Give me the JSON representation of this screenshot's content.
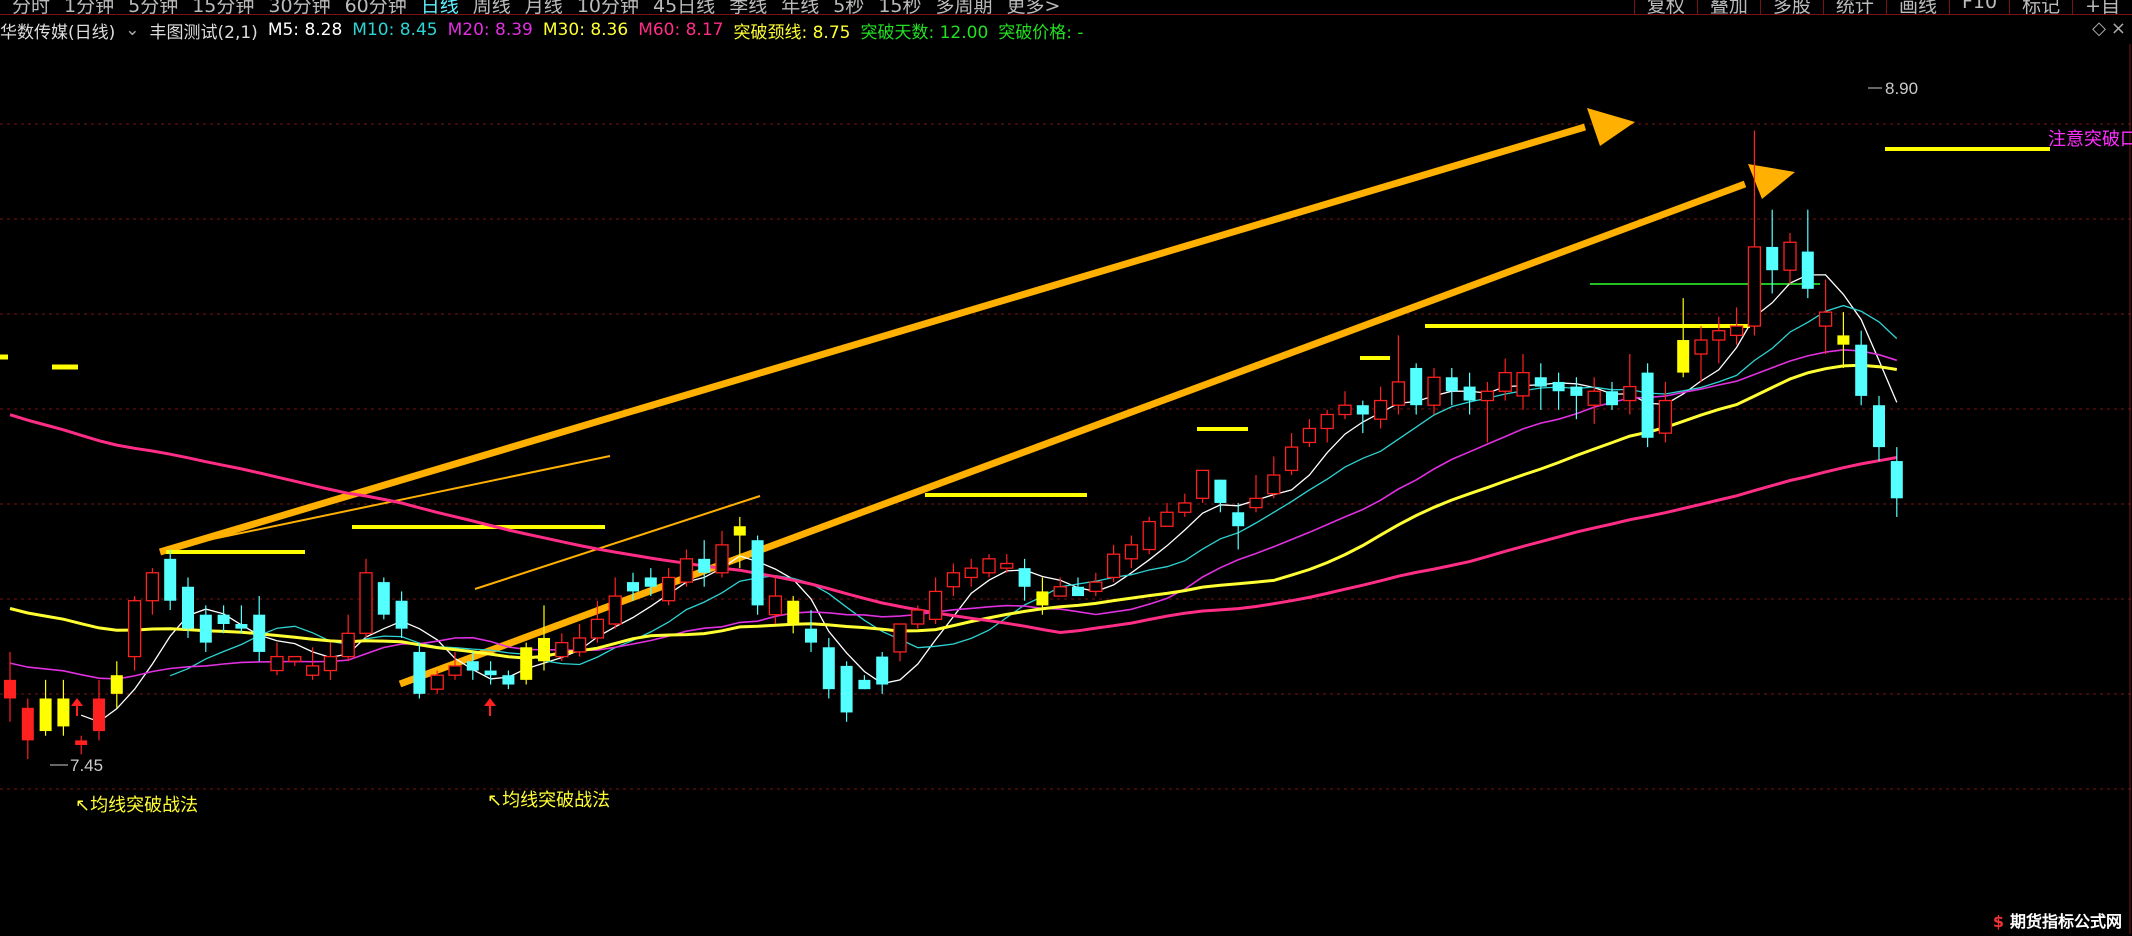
{
  "topbar": {
    "periods": [
      "分时",
      "1分钟",
      "5分钟",
      "15分钟",
      "30分钟",
      "60分钟",
      "日线",
      "周线",
      "月线",
      "10分钟",
      "45日线",
      "季线",
      "年线",
      "5秒",
      "15秒",
      "多周期",
      "更多>"
    ],
    "active_period": "日线",
    "tools": [
      "复权",
      "叠加",
      "多股",
      "统计",
      "画线",
      "F10",
      "标记",
      "+自"
    ]
  },
  "info": {
    "stock_name": "华数传媒(日线)",
    "indicator": "丰图测试(2,1)",
    "ma5": "M5: 8.28",
    "ma10": "M10: 8.45",
    "ma20": "M20: 8.39",
    "ma30": "M30: 8.36",
    "ma60": "M60: 8.17",
    "neckline": "突破颈线: 8.75",
    "days": "突破天数: 12.00",
    "price": "突破价格: -"
  },
  "annotations": {
    "high": "8.90",
    "low": "7.45",
    "note1": "↖均线突破战法",
    "note2": "↖均线突破战法",
    "alert": "注意突破口"
  },
  "watermark": {
    "symbol": "$",
    "text": "期货指标公式网"
  },
  "colors": {
    "up": "#ff2020",
    "down": "#54ffff",
    "mark": "#ffff00",
    "ma5": "#ffffff",
    "ma10": "#2ed3d3",
    "ma20": "#e030e0",
    "ma30": "#ffff33",
    "ma60": "#ff2d86",
    "arrow": "#ffb000",
    "grid": "#7a1414"
  },
  "chart_data": {
    "type": "candlestick",
    "price_high": 8.9,
    "price_low": 7.45,
    "candles": [
      [
        "o",
        7.62,
        7.58,
        7.68,
        7.53
      ],
      [
        "o",
        7.56,
        7.49,
        7.58,
        7.45
      ],
      [
        "y",
        7.51,
        7.58,
        7.62,
        7.5
      ],
      [
        "y",
        7.52,
        7.58,
        7.62,
        7.5
      ],
      [
        "o",
        7.48,
        7.49,
        7.5,
        7.46
      ],
      [
        "o",
        7.58,
        7.51,
        7.62,
        7.49
      ],
      [
        "y",
        7.59,
        7.63,
        7.66,
        7.56
      ],
      [
        "r",
        7.67,
        7.79,
        7.8,
        7.64
      ],
      [
        "r",
        7.79,
        7.85,
        7.86,
        7.76
      ],
      [
        "c",
        7.88,
        7.79,
        7.9,
        7.77
      ],
      [
        "c",
        7.82,
        7.73,
        7.84,
        7.71
      ],
      [
        "c",
        7.76,
        7.7,
        7.78,
        7.68
      ],
      [
        "c",
        7.76,
        7.74,
        7.78,
        7.72
      ],
      [
        "c",
        7.74,
        7.73,
        7.78,
        7.72
      ],
      [
        "c",
        7.76,
        7.68,
        7.8,
        7.66
      ],
      [
        "r",
        7.64,
        7.67,
        7.7,
        7.63
      ],
      [
        "r",
        7.66,
        7.67,
        7.67,
        7.65
      ],
      [
        "r",
        7.63,
        7.65,
        7.69,
        7.62
      ],
      [
        "r",
        7.64,
        7.67,
        7.7,
        7.62
      ],
      [
        "r",
        7.67,
        7.72,
        7.76,
        7.66
      ],
      [
        "r",
        7.72,
        7.85,
        7.88,
        7.71
      ],
      [
        "c",
        7.83,
        7.76,
        7.84,
        7.75
      ],
      [
        "c",
        7.79,
        7.73,
        7.81,
        7.71
      ],
      [
        "c",
        7.68,
        7.59,
        7.7,
        7.58
      ],
      [
        "r",
        7.63,
        7.6,
        7.64,
        7.59
      ],
      [
        "r",
        7.63,
        7.65,
        7.68,
        7.62
      ],
      [
        "c",
        7.66,
        7.64,
        7.68,
        7.62
      ],
      [
        "c",
        7.64,
        7.63,
        7.66,
        7.61
      ],
      [
        "c",
        7.63,
        7.61,
        7.64,
        7.6
      ],
      [
        "y",
        7.62,
        7.69,
        7.7,
        7.61
      ],
      [
        "y",
        7.66,
        7.71,
        7.78,
        7.64
      ],
      [
        "r",
        7.67,
        7.7,
        7.72,
        7.66
      ],
      [
        "r",
        7.68,
        7.71,
        7.74,
        7.67
      ],
      [
        "r",
        7.71,
        7.75,
        7.79,
        7.7
      ],
      [
        "r",
        7.74,
        7.8,
        7.84,
        7.73
      ],
      [
        "c",
        7.83,
        7.81,
        7.85,
        7.79
      ],
      [
        "c",
        7.84,
        7.82,
        7.86,
        7.8
      ],
      [
        "r",
        7.79,
        7.84,
        7.86,
        7.78
      ],
      [
        "r",
        7.83,
        7.88,
        7.9,
        7.82
      ],
      [
        "c",
        7.88,
        7.85,
        7.92,
        7.82
      ],
      [
        "r",
        7.85,
        7.91,
        7.94,
        7.84
      ],
      [
        "y",
        7.93,
        7.95,
        7.97,
        7.86
      ],
      [
        "c",
        7.92,
        7.78,
        7.93,
        7.76
      ],
      [
        "r",
        7.76,
        7.8,
        7.84,
        7.74
      ],
      [
        "y",
        7.79,
        7.74,
        7.8,
        7.72
      ],
      [
        "c",
        7.73,
        7.7,
        7.77,
        7.68
      ],
      [
        "c",
        7.69,
        7.6,
        7.71,
        7.58
      ],
      [
        "c",
        7.65,
        7.55,
        7.66,
        7.53
      ],
      [
        "c",
        7.62,
        7.6,
        7.63,
        7.6
      ],
      [
        "c",
        7.67,
        7.61,
        7.68,
        7.59
      ],
      [
        "r",
        7.68,
        7.74,
        7.74,
        7.66
      ],
      [
        "r",
        7.74,
        7.77,
        7.78,
        7.73
      ],
      [
        "r",
        7.75,
        7.81,
        7.84,
        7.74
      ],
      [
        "r",
        7.82,
        7.85,
        7.87,
        7.8
      ],
      [
        "r",
        7.84,
        7.86,
        7.88,
        7.82
      ],
      [
        "r",
        7.85,
        7.88,
        7.89,
        7.84
      ],
      [
        "r",
        7.86,
        7.87,
        7.89,
        7.85
      ],
      [
        "c",
        7.86,
        7.82,
        7.88,
        7.79
      ],
      [
        "y",
        7.81,
        7.78,
        7.84,
        7.76
      ],
      [
        "r",
        7.8,
        7.82,
        7.84,
        7.8
      ],
      [
        "c",
        7.82,
        7.8,
        7.84,
        7.8
      ],
      [
        "r",
        7.81,
        7.83,
        7.85,
        7.8
      ],
      [
        "r",
        7.84,
        7.89,
        7.91,
        7.83
      ],
      [
        "r",
        7.88,
        7.91,
        7.93,
        7.86
      ],
      [
        "r",
        7.9,
        7.96,
        7.97,
        7.89
      ],
      [
        "r",
        7.98,
        7.95,
        8.0,
        7.96
      ],
      [
        "r",
        7.98,
        8.0,
        8.02,
        7.97
      ],
      [
        "r",
        8.01,
        8.07,
        8.06,
        8.0
      ],
      [
        "c",
        8.05,
        8.0,
        8.05,
        7.98
      ],
      [
        "c",
        7.98,
        7.95,
        8.0,
        7.9
      ],
      [
        "r",
        7.99,
        8.01,
        8.06,
        7.98
      ],
      [
        "r",
        8.02,
        8.06,
        8.1,
        8.01
      ],
      [
        "r",
        8.07,
        8.12,
        8.15,
        8.06
      ],
      [
        "r",
        8.13,
        8.16,
        8.18,
        8.12
      ],
      [
        "r",
        8.16,
        8.19,
        8.2,
        8.13
      ],
      [
        "r",
        8.19,
        8.21,
        8.24,
        8.18
      ],
      [
        "c",
        8.21,
        8.19,
        8.22,
        8.15
      ],
      [
        "r",
        8.18,
        8.22,
        8.25,
        8.16
      ],
      [
        "r",
        8.21,
        8.26,
        8.36,
        8.19
      ],
      [
        "c",
        8.29,
        8.21,
        8.3,
        8.19
      ],
      [
        "r",
        8.21,
        8.27,
        8.29,
        8.19
      ],
      [
        "c",
        8.27,
        8.24,
        8.29,
        8.21
      ],
      [
        "c",
        8.25,
        8.22,
        8.28,
        8.19
      ],
      [
        "r",
        8.22,
        8.24,
        8.26,
        8.13
      ],
      [
        "r",
        8.24,
        8.28,
        8.31,
        8.22
      ],
      [
        "r",
        8.23,
        8.28,
        8.32,
        8.2
      ],
      [
        "c",
        8.27,
        8.25,
        8.3,
        8.2
      ],
      [
        "c",
        8.26,
        8.24,
        8.28,
        8.2
      ],
      [
        "c",
        8.25,
        8.23,
        8.27,
        8.18
      ],
      [
        "r",
        8.21,
        8.24,
        8.27,
        8.17
      ],
      [
        "c",
        8.24,
        8.21,
        8.26,
        8.2
      ],
      [
        "r",
        8.22,
        8.25,
        8.32,
        8.19
      ],
      [
        "c",
        8.28,
        8.14,
        8.3,
        8.12
      ],
      [
        "r",
        8.15,
        8.22,
        8.26,
        8.13
      ],
      [
        "y",
        8.28,
        8.35,
        8.44,
        8.27
      ],
      [
        "r",
        8.32,
        8.35,
        8.38,
        8.26
      ],
      [
        "r",
        8.35,
        8.37,
        8.4,
        8.3
      ],
      [
        "r",
        8.36,
        8.38,
        8.42,
        8.34
      ],
      [
        "r",
        8.38,
        8.55,
        8.8,
        8.36
      ],
      [
        "c",
        8.55,
        8.5,
        8.63,
        8.45
      ],
      [
        "r",
        8.5,
        8.56,
        8.58,
        8.47
      ],
      [
        "c",
        8.54,
        8.46,
        8.63,
        8.44
      ],
      [
        "r",
        8.41,
        8.38,
        8.48,
        8.32
      ],
      [
        "y",
        8.36,
        8.34,
        8.41,
        8.29
      ],
      [
        "c",
        8.34,
        8.23,
        8.37,
        8.21
      ],
      [
        "c",
        8.21,
        8.12,
        8.23,
        8.09
      ],
      [
        "c",
        8.09,
        8.01,
        8.12,
        7.97
      ]
    ]
  }
}
